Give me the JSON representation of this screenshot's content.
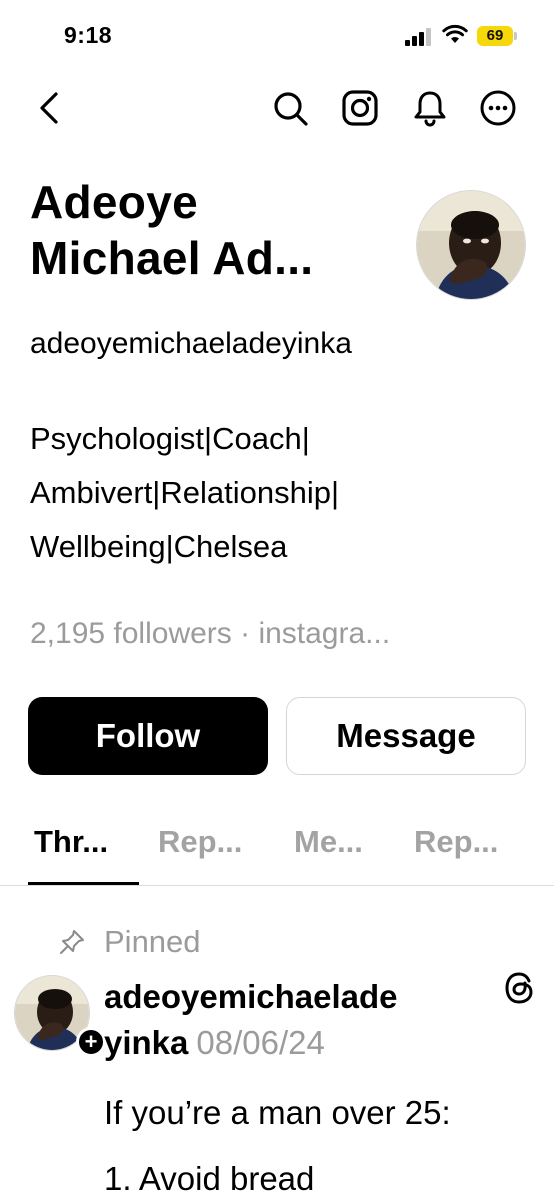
{
  "status_bar": {
    "time": "9:18",
    "battery_level": "69",
    "battery_color": "#f6d70a"
  },
  "nav": {
    "icons": [
      "back-chevron-icon",
      "search-icon",
      "instagram-icon",
      "bell-icon",
      "more-options-icon"
    ]
  },
  "profile": {
    "name_line1": "Adeoye",
    "name_line2": "Michael Ad...",
    "username": "adeoyemichaeladeyinka",
    "bio_lines": [
      "Psychologist|Coach|",
      "Ambivert|Relationship|",
      "Wellbeing|Chelsea"
    ],
    "meta": "2,195 followers · instagra..."
  },
  "actions": {
    "follow_label": "Follow",
    "message_label": "Message"
  },
  "tabs": [
    {
      "label": "Thr...",
      "active": true
    },
    {
      "label": "Rep...",
      "active": false
    },
    {
      "label": "Me...",
      "active": false
    },
    {
      "label": "Rep...",
      "active": false
    }
  ],
  "post": {
    "pinned_label": "Pinned",
    "author_line1": "adeoyemichaelade",
    "author_line2": "yinka",
    "date": "08/06/24",
    "body_lines": [
      "If you’re a man over 25:",
      "1. Avoid bread"
    ]
  }
}
